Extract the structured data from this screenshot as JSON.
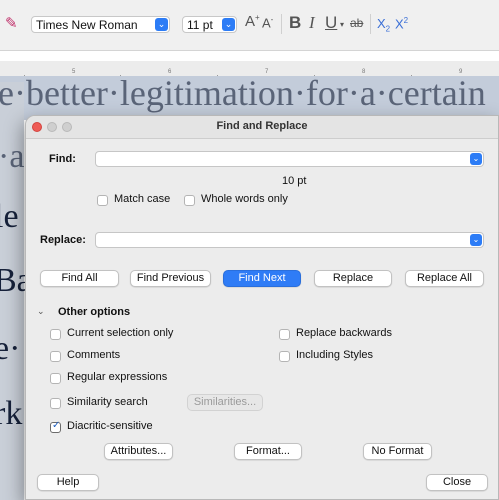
{
  "toolbar": {
    "font_name": "Times New Roman",
    "font_size": "11 pt",
    "buttons": {
      "grow": "A",
      "shrink": "A",
      "bold": "B",
      "italic": "I",
      "underline": "U",
      "strikethrough": "ab",
      "subscript": "X",
      "subscript_sub": "2",
      "superscript": "X",
      "superscript_sup": "2"
    }
  },
  "ruler": {
    "numbers": [
      "5",
      "6",
      "7",
      "8",
      "9"
    ]
  },
  "document": {
    "lines": [
      "e·better·legitimation·for·a·certain",
      "·a",
      "le",
      "Ba",
      "e·",
      "rk"
    ]
  },
  "dialog": {
    "title": "Find and Replace",
    "find": {
      "label": "Find:",
      "value": ""
    },
    "font_note": "10 pt",
    "match_case": {
      "label": "Match case",
      "checked": false
    },
    "whole_words": {
      "label": "Whole words only",
      "checked": false
    },
    "replace": {
      "label": "Replace:",
      "value": ""
    },
    "buttons": {
      "find_all": "Find All",
      "find_previous": "Find Previous",
      "find_next": "Find Next",
      "replace": "Replace",
      "replace_all": "Replace All"
    },
    "other_options_label": "Other options",
    "options": {
      "current_selection_only": {
        "label": "Current selection only",
        "checked": false
      },
      "replace_backwards": {
        "label": "Replace backwards",
        "checked": false
      },
      "comments": {
        "label": "Comments",
        "checked": false
      },
      "including_styles": {
        "label": "Including Styles",
        "checked": false
      },
      "regular_expressions": {
        "label": "Regular expressions",
        "checked": false
      },
      "similarity_search": {
        "label": "Similarity search",
        "checked": false
      },
      "diacritic_sensitive": {
        "label": "Diacritic-sensitive",
        "checked": true
      }
    },
    "similarities_button": "Similarities...",
    "attributes_button": "Attributes...",
    "format_button": "Format...",
    "no_format_button": "No Format",
    "help_button": "Help",
    "close_button": "Close"
  },
  "colors": {
    "accent": "#2f7cf6",
    "dialog_bg": "#ececec",
    "selection_bg": "#c3ccda"
  }
}
